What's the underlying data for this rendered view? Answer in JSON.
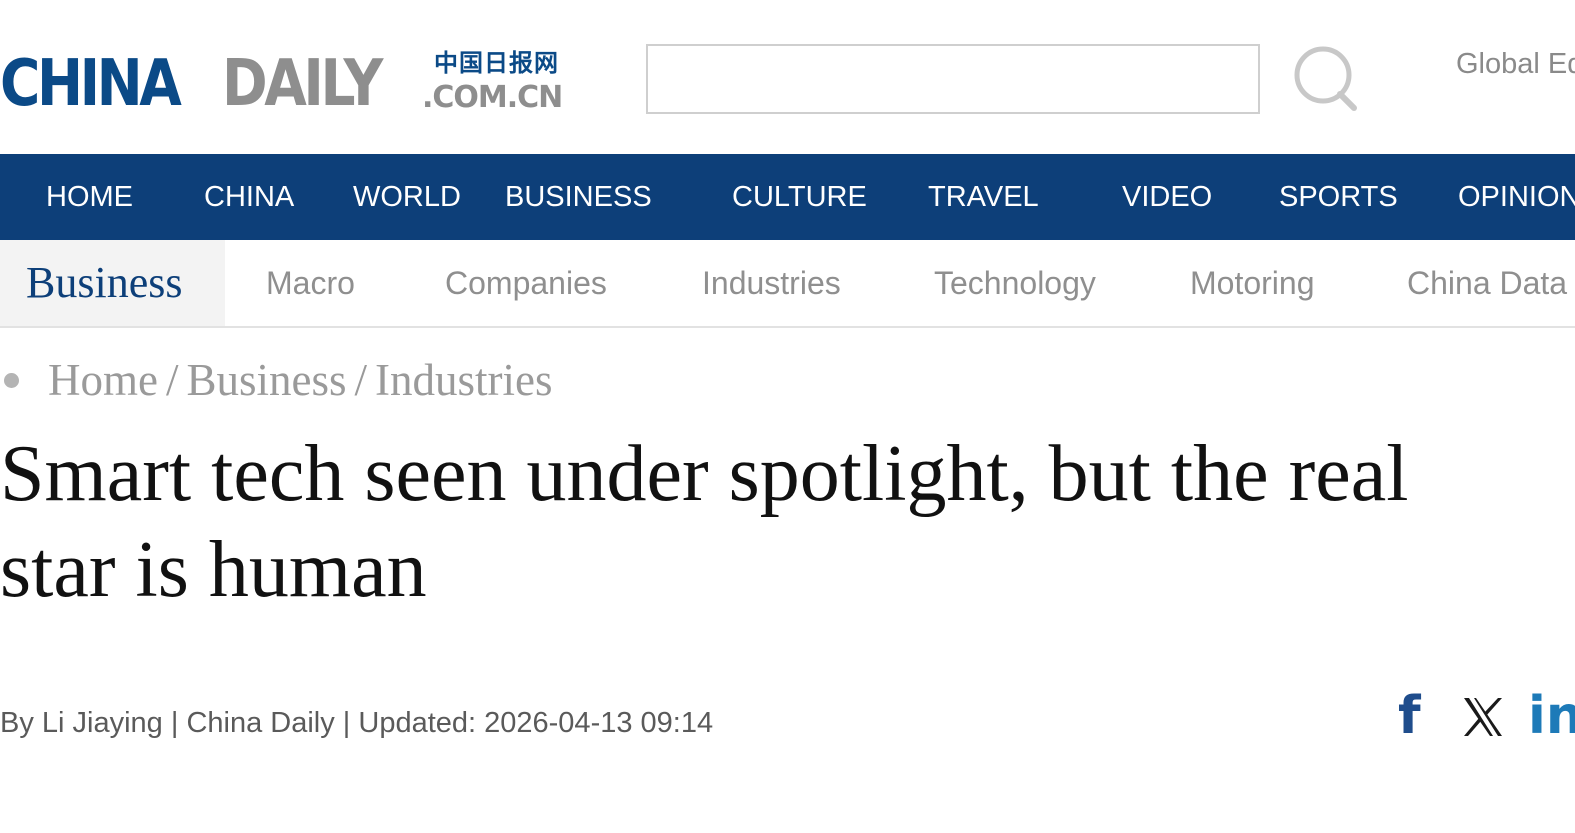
{
  "logo": {
    "part1": "CHINA",
    "part2": "DAILY",
    "chinese": "中国日报网",
    "domain": ".COM.CN"
  },
  "search": {
    "value": "",
    "placeholder": ""
  },
  "header": {
    "edition_link": "Global Edition"
  },
  "main_nav": {
    "items": [
      "HOME",
      "CHINA",
      "WORLD",
      "BUSINESS",
      "CULTURE",
      "TRAVEL",
      "VIDEO",
      "SPORTS",
      "OPINION"
    ]
  },
  "sub_nav": {
    "section": "Business",
    "items": [
      "Macro",
      "Companies",
      "Industries",
      "Technology",
      "Motoring",
      "China Data"
    ]
  },
  "breadcrumb": {
    "items": [
      "Home",
      "Business",
      "Industries"
    ],
    "separator": "/"
  },
  "article": {
    "headline_line1": "Smart tech seen under spotlight, but the real",
    "headline_line2": "star is human",
    "byline": "By Li Jiaying | China Daily | Updated: 2026-04-13 09:14"
  },
  "share": {
    "facebook_glyph": "f",
    "linkedin_glyph": "in",
    "icons": [
      "facebook-icon",
      "x-icon",
      "linkedin-icon"
    ]
  },
  "colors": {
    "brand_blue": "#0d3f79",
    "logo_gray": "#8e8e8e",
    "muted_text": "#8f8f8f",
    "facebook": "#1f4d8c",
    "linkedin": "#1d7ab8"
  }
}
